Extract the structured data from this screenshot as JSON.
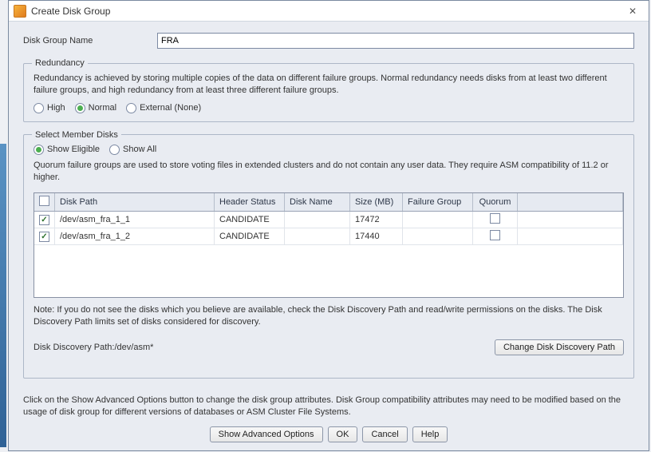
{
  "window": {
    "title": "Create Disk Group",
    "close_label": "✕"
  },
  "diskGroupName": {
    "label": "Disk Group Name",
    "value": "FRA"
  },
  "redundancy": {
    "legend": "Redundancy",
    "desc": "Redundancy is achieved by storing multiple copies of the data on different failure groups. Normal redundancy needs disks from at least two different failure groups, and high redundancy from at least three different failure groups.",
    "options": {
      "high": "High",
      "normal": "Normal",
      "external": "External (None)"
    },
    "selected": "normal"
  },
  "memberDisks": {
    "legend": "Select Member Disks",
    "filter": {
      "eligible": "Show Eligible",
      "all": "Show All",
      "selected": "eligible"
    },
    "quorum_desc": "Quorum failure groups are used to store voting files in extended clusters and do not contain any user data. They require ASM compatibility of 11.2 or higher.",
    "columns": {
      "path": "Disk Path",
      "status": "Header Status",
      "name": "Disk Name",
      "size": "Size (MB)",
      "fg": "Failure Group",
      "quorum": "Quorum"
    },
    "rows": [
      {
        "checked": true,
        "path": "/dev/asm_fra_1_1",
        "status": "CANDIDATE",
        "name": "",
        "size": "17472",
        "fg": "",
        "quorum": false
      },
      {
        "checked": true,
        "path": "/dev/asm_fra_1_2",
        "status": "CANDIDATE",
        "name": "",
        "size": "17440",
        "fg": "",
        "quorum": false
      }
    ],
    "note": "Note: If you do not see the disks which you believe are available, check the Disk Discovery Path and read/write permissions on the disks. The Disk Discovery Path limits set of disks considered for discovery.",
    "discovery": {
      "label": "Disk Discovery Path:",
      "value": "/dev/asm*",
      "btn": "Change Disk Discovery Path"
    }
  },
  "footer": {
    "text": "Click on the Show Advanced Options button to change the disk group attributes. Disk Group compatibility attributes may need to be modified based on the usage of disk group for different versions of databases or ASM Cluster File Systems.",
    "buttons": {
      "advanced": "Show Advanced Options",
      "ok": "OK",
      "cancel": "Cancel",
      "help": "Help"
    }
  }
}
